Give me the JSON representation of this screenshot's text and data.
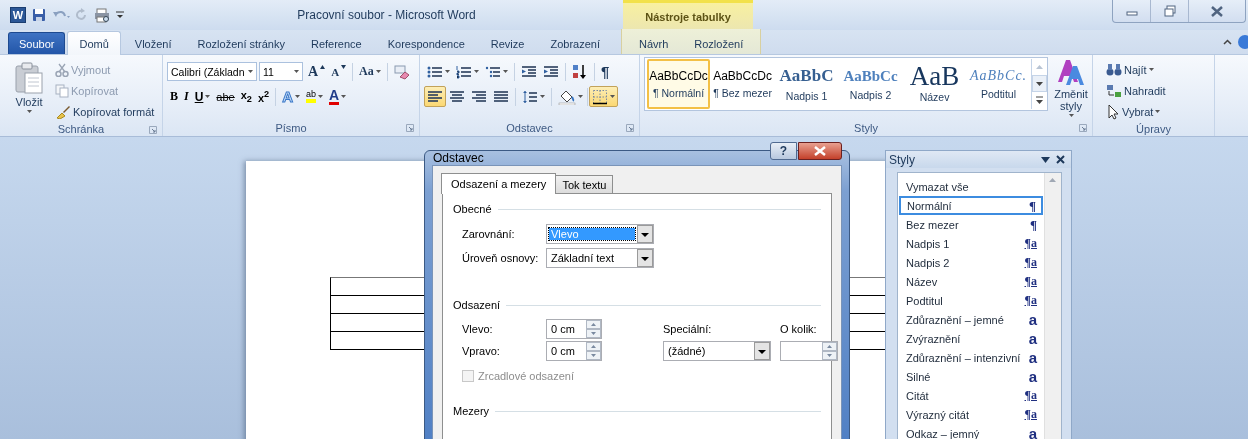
{
  "window": {
    "app_letter": "W",
    "title": "Pracovní soubor - Microsoft Word",
    "context_group": "Nástroje tabulky"
  },
  "ribbon_tabs": [
    {
      "label": "Soubor",
      "kind": "file",
      "selected": false
    },
    {
      "label": "Domů",
      "kind": "tab",
      "selected": true
    },
    {
      "label": "Vložení",
      "kind": "tab",
      "selected": false
    },
    {
      "label": "Rozložení stránky",
      "kind": "tab",
      "selected": false
    },
    {
      "label": "Reference",
      "kind": "tab",
      "selected": false
    },
    {
      "label": "Korespondence",
      "kind": "tab",
      "selected": false
    },
    {
      "label": "Revize",
      "kind": "tab",
      "selected": false
    },
    {
      "label": "Zobrazení",
      "kind": "tab",
      "selected": false
    },
    {
      "label": "Návrh",
      "kind": "context",
      "selected": false
    },
    {
      "label": "Rozložení",
      "kind": "context",
      "selected": false
    }
  ],
  "ribbon": {
    "clipboard": {
      "label": "Schránka",
      "paste": "Vložit",
      "items": [
        {
          "label": "Vyjmout",
          "disabled": true
        },
        {
          "label": "Kopírovat",
          "disabled": true
        },
        {
          "label": "Kopírovat formát",
          "disabled": false
        }
      ]
    },
    "font": {
      "label": "Písmo",
      "font_name": "Calibri (Základn",
      "font_size": "11",
      "top_buttons": [
        {
          "kind": "grow",
          "label": "A",
          "dropdown": false
        },
        {
          "kind": "shrink",
          "label": "A",
          "dropdown": false
        },
        {
          "kind": "case",
          "label": "Aa",
          "dropdown": true
        }
      ],
      "bottom_buttons": [
        {
          "kind": "bold",
          "label": "B",
          "dropdown": false
        },
        {
          "kind": "italic",
          "label": "I",
          "dropdown": false
        },
        {
          "kind": "underline",
          "label": "U",
          "dropdown": true
        },
        {
          "kind": "strike",
          "label": "abe",
          "dropdown": false
        },
        {
          "kind": "sub",
          "label": "x$_{2}$",
          "dropdown": false
        },
        {
          "kind": "sup",
          "label": "x$^{2}$",
          "dropdown": false
        },
        {
          "kind": "effects",
          "label": "A",
          "dropdown": true
        },
        {
          "kind": "highlight",
          "label": "ab",
          "dropdown": true
        },
        {
          "kind": "color",
          "label": "A",
          "dropdown": true
        }
      ]
    },
    "paragraph": {
      "label": "Odstavec",
      "pilcrow": "¶",
      "alignments": [
        {
          "selected": true
        },
        {
          "selected": false
        },
        {
          "selected": false
        },
        {
          "selected": false
        }
      ],
      "borders": {
        "selected": true
      }
    },
    "styles": {
      "label": "Styly",
      "change": "Změnit styly",
      "items": [
        {
          "preview": "AaBbCcDc",
          "name": "¶ Normální",
          "kind": "normal",
          "selected": true
        },
        {
          "preview": "AaBbCcDc",
          "name": "¶ Bez mezer",
          "kind": "normal",
          "selected": false
        },
        {
          "preview": "AaBbC",
          "name": "Nadpis 1",
          "kind": "heading1",
          "selected": false
        },
        {
          "preview": "AaBbCc",
          "name": "Nadpis 2",
          "kind": "heading2",
          "selected": false
        },
        {
          "preview": "AaB",
          "name": "Název",
          "kind": "title",
          "selected": false
        },
        {
          "preview": "AaBbCc.",
          "name": "Podtitul",
          "kind": "subtitle",
          "selected": false
        }
      ]
    },
    "editing": {
      "label": "Úpravy",
      "items": [
        {
          "label": "Najít",
          "dropdown": true
        },
        {
          "label": "Nahradit",
          "dropdown": false
        },
        {
          "label": "Vybrat",
          "dropdown": true
        }
      ]
    }
  },
  "dialog": {
    "title": "Odstavec",
    "help": "?",
    "tabs": [
      {
        "label": "Odsazení a mezery",
        "selected": true
      },
      {
        "label": "Tok textu",
        "selected": false
      }
    ],
    "general": {
      "heading": "Obecné",
      "fields": [
        {
          "label": "Zarovnání:",
          "value": "Vlevo",
          "focused": true
        },
        {
          "label": "Úroveň osnovy:",
          "value": "Základní text",
          "focused": false
        }
      ]
    },
    "indent": {
      "heading": "Odsazení",
      "left": {
        "label": "Vlevo:",
        "value": "0 cm"
      },
      "right": {
        "label": "Vpravo:",
        "value": "0 cm"
      },
      "special": {
        "label": "Speciální:",
        "value": "(žádné)"
      },
      "by": {
        "label": "O kolik:"
      },
      "mirror": {
        "label": "Zrcadlové odsazení",
        "checked": false,
        "disabled": true
      }
    },
    "spacing": {
      "heading": "Mezery"
    }
  },
  "styles_pane": {
    "title": "Styly",
    "items": [
      {
        "label": "Vymazat vše",
        "kind": "clear",
        "selected": false
      },
      {
        "label": "Normální",
        "kind": "paragraph",
        "mark": "¶",
        "selected": true
      },
      {
        "label": "Bez mezer",
        "kind": "paragraph",
        "mark": "¶",
        "selected": false
      },
      {
        "label": "Nadpis 1",
        "kind": "linked",
        "mark": "¶a",
        "selected": false
      },
      {
        "label": "Nadpis 2",
        "kind": "linked",
        "mark": "¶a",
        "selected": false
      },
      {
        "label": "Název",
        "kind": "linked",
        "mark": "¶a",
        "selected": false
      },
      {
        "label": "Podtitul",
        "kind": "linked",
        "mark": "¶a",
        "selected": false
      },
      {
        "label": "Zdůraznění – jemné",
        "kind": "character",
        "mark": "a",
        "selected": false
      },
      {
        "label": "Zvýraznění",
        "kind": "character",
        "mark": "a",
        "selected": false
      },
      {
        "label": "Zdůraznění – intenzivní",
        "kind": "character",
        "mark": "a",
        "selected": false
      },
      {
        "label": "Silné",
        "kind": "character",
        "mark": "a",
        "selected": false
      },
      {
        "label": "Citát",
        "kind": "linked",
        "mark": "¶a",
        "selected": false
      },
      {
        "label": "Výrazný citát",
        "kind": "linked",
        "mark": "¶a",
        "selected": false
      },
      {
        "label": "Odkaz – jemný",
        "kind": "character",
        "mark": "a",
        "selected": false
      }
    ]
  }
}
